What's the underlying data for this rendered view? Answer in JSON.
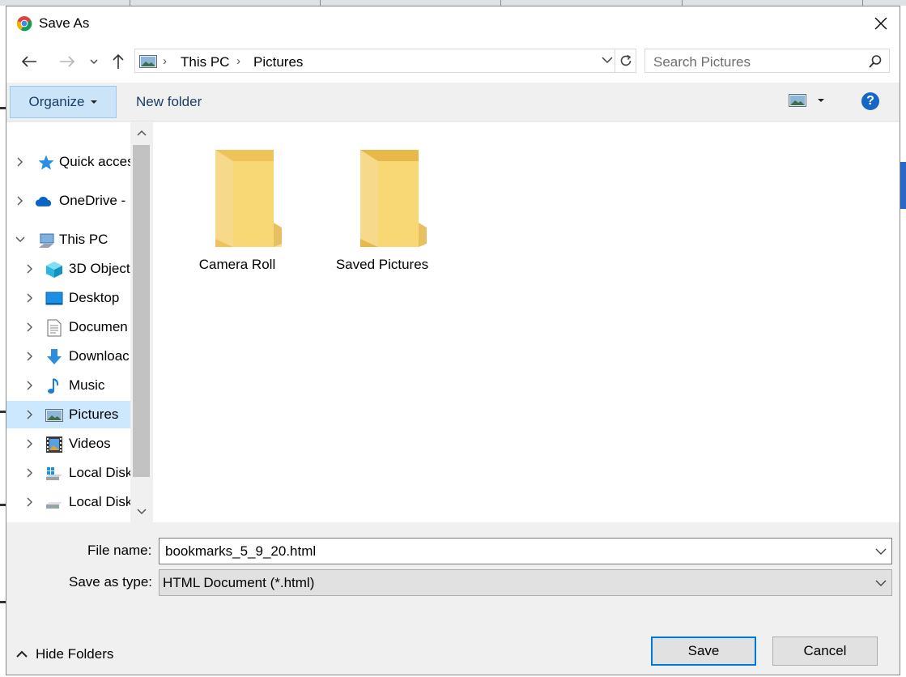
{
  "dialog": {
    "title": "Save As",
    "colors": {
      "accent": "#0078d7",
      "selection": "#cce8ff",
      "organize_bg": "#cce4f7",
      "folder": "#f8d775"
    }
  },
  "navigation": {
    "breadcrumb": [
      "This PC",
      "Pictures"
    ],
    "search_placeholder": "Search Pictures",
    "icons": [
      "back-arrow-icon",
      "forward-arrow-icon",
      "recent-locations-icon",
      "up-arrow-icon",
      "refresh-icon",
      "search-icon"
    ]
  },
  "toolbar": {
    "organize_label": "Organize",
    "new_folder_label": "New folder",
    "help_label": "?"
  },
  "tree": {
    "items": [
      {
        "label": "Quick acces",
        "icon": "star-icon",
        "expanded": false,
        "level": 0
      },
      {
        "label": "OneDrive -",
        "icon": "cloud-icon",
        "expanded": false,
        "level": 0
      },
      {
        "label": "This PC",
        "icon": "computer-icon",
        "expanded": true,
        "level": 0
      },
      {
        "label": "3D Object",
        "icon": "cube-icon",
        "expanded": false,
        "level": 1
      },
      {
        "label": "Desktop",
        "icon": "desktop-icon",
        "expanded": false,
        "level": 1
      },
      {
        "label": "Documen",
        "icon": "document-icon",
        "expanded": false,
        "level": 1
      },
      {
        "label": "Downloac",
        "icon": "download-icon",
        "expanded": false,
        "level": 1
      },
      {
        "label": "Music",
        "icon": "music-icon",
        "expanded": false,
        "level": 1
      },
      {
        "label": "Pictures",
        "icon": "pictures-icon",
        "expanded": false,
        "level": 1,
        "selected": true
      },
      {
        "label": "Videos",
        "icon": "videos-icon",
        "expanded": false,
        "level": 1
      },
      {
        "label": "Local Disk",
        "icon": "windows-drive-icon",
        "expanded": false,
        "level": 1
      },
      {
        "label": "Local Disk",
        "icon": "drive-icon",
        "expanded": false,
        "level": 1
      }
    ]
  },
  "content": {
    "folders": [
      {
        "name": "Camera Roll"
      },
      {
        "name": "Saved Pictures"
      }
    ]
  },
  "form": {
    "file_name_label": "File name:",
    "file_name_value": "bookmarks_5_9_20.html",
    "save_as_type_label": "Save as type:",
    "save_as_type_value": "HTML Document (*.html)",
    "hide_folders_label": "Hide Folders",
    "save_label": "Save",
    "cancel_label": "Cancel"
  }
}
